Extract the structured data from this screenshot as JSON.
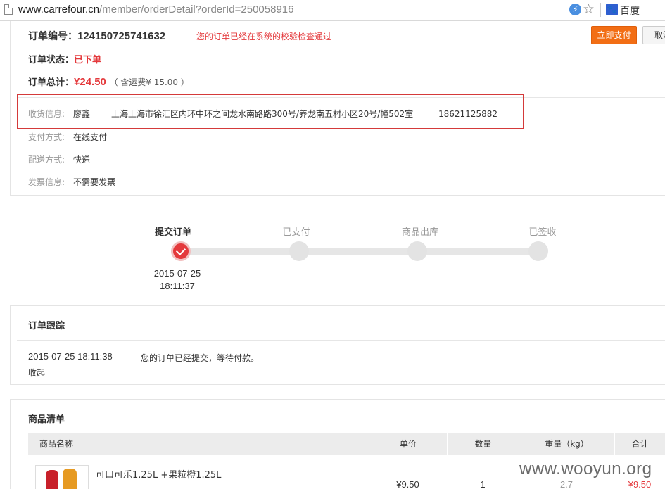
{
  "browser": {
    "url_host": "www.carrefour.cn",
    "url_path": "/member/orderDetail?orderId=250058916",
    "bolt_glyph": "⚡",
    "star_glyph": "☆",
    "paw_glyph": "🐾",
    "search_engine": "百度"
  },
  "order": {
    "number_label": "订单编号：",
    "number": "124150725741632",
    "notice": "您的订单已经在系统的校验检查通过",
    "status_label": "订单状态：",
    "status": "已下单",
    "total_label": "订单总计：",
    "total": "¥24.50",
    "shipping_note": "（ 含运费¥ 15.00 ）",
    "pay_button": "立即支付",
    "cancel_button": "取消"
  },
  "details": {
    "address_label": "收货信息:",
    "recipient": "廖鑫",
    "address": "上海上海市徐汇区内环中环之间龙水南路路300号/养龙南五村小区20号/幢502室",
    "phone": "18621125882",
    "payment_label": "支付方式:",
    "payment": "在线支付",
    "delivery_label": "配送方式:",
    "delivery": "快递",
    "invoice_label": "发票信息:",
    "invoice": "不需要发票"
  },
  "progress": {
    "steps": [
      {
        "label": "提交订单",
        "done": true
      },
      {
        "label": "已支付",
        "done": false
      },
      {
        "label": "商品出库",
        "done": false
      },
      {
        "label": "已签收",
        "done": false
      }
    ],
    "first_date": "2015-07-25",
    "first_time": "18:11:37"
  },
  "tracking": {
    "title": "订单跟踪",
    "entries": [
      {
        "time": "2015-07-25 18:11:38",
        "text": "您的订单已经提交，等待付款。"
      }
    ],
    "collapse_label": "收起"
  },
  "goods": {
    "title": "商品清单",
    "columns": [
      "商品名称",
      "单价",
      "数量",
      "重量（kg）",
      "合计"
    ],
    "items": [
      {
        "name": "可口可乐1.25L +果粒橙1.25L",
        "price": "¥9.50",
        "qty": "1",
        "weight": "2.7",
        "sum": "¥9.50"
      }
    ]
  },
  "watermark": "www.wooyun.org",
  "colors": {
    "accent": "#e4393c",
    "button": "#f26e15",
    "highlight_box": "#d43a3a"
  }
}
